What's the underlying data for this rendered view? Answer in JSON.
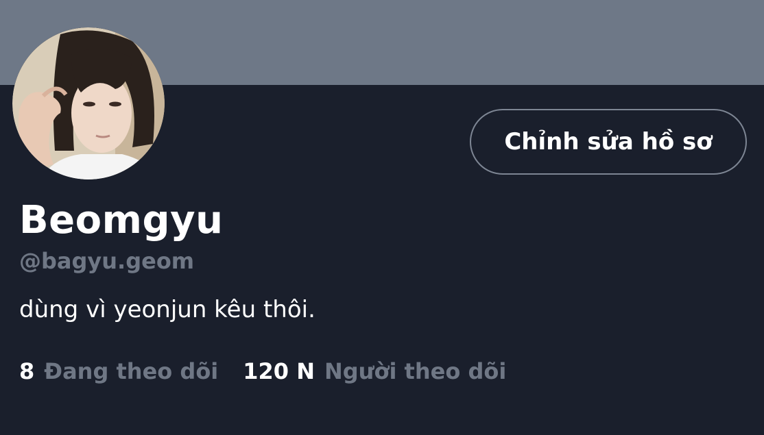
{
  "profile": {
    "display_name": "Beomgyu",
    "handle": "@bagyu.geom",
    "bio": "dùng vì yeonjun kêu thôi.",
    "edit_button_label": "Chỉnh sửa hồ sơ"
  },
  "stats": {
    "following_count": "8",
    "following_label": "Đang theo dõi",
    "followers_count": "120 N",
    "followers_label": "Người theo dõi"
  },
  "colors": {
    "background": "#1a1f2c",
    "banner": "#6e7887",
    "muted_text": "#6f7785",
    "primary_text": "#ffffff",
    "button_border": "#7e8694"
  },
  "icons": {
    "avatar": "profile-photo"
  }
}
